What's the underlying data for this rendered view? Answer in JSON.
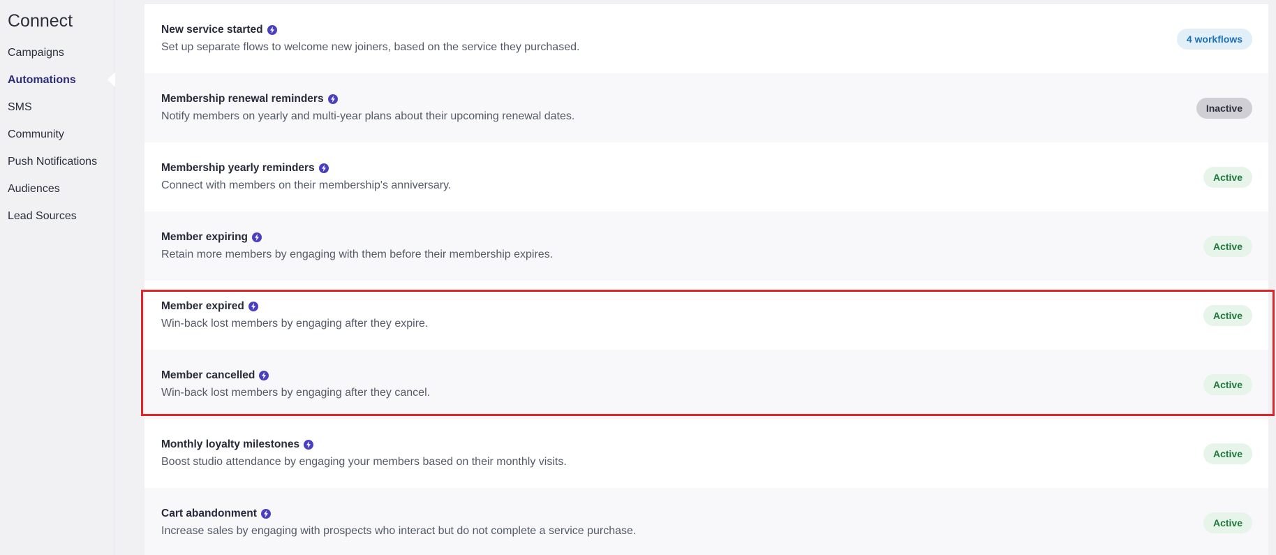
{
  "sidebar": {
    "title": "Connect",
    "items": [
      {
        "label": "Campaigns",
        "active": false
      },
      {
        "label": "Automations",
        "active": true
      },
      {
        "label": "SMS",
        "active": false
      },
      {
        "label": "Community",
        "active": false
      },
      {
        "label": "Push Notifications",
        "active": false
      },
      {
        "label": "Audiences",
        "active": false
      },
      {
        "label": "Lead Sources",
        "active": false
      }
    ]
  },
  "automations": [
    {
      "title": "New service started",
      "description": "Set up separate flows to welcome new joiners, based on the service they purchased.",
      "status": "4 workflows",
      "status_type": "workflows"
    },
    {
      "title": "Membership renewal reminders",
      "description": "Notify members on yearly and multi-year plans about their upcoming renewal dates.",
      "status": "Inactive",
      "status_type": "inactive"
    },
    {
      "title": "Membership yearly reminders",
      "description": "Connect with members on their membership's anniversary.",
      "status": "Active",
      "status_type": "active"
    },
    {
      "title": "Member expiring",
      "description": "Retain more members by engaging with them before their membership expires.",
      "status": "Active",
      "status_type": "active"
    },
    {
      "title": "Member expired",
      "description": "Win-back lost members by engaging after they expire.",
      "status": "Active",
      "status_type": "active"
    },
    {
      "title": "Member cancelled",
      "description": "Win-back lost members by engaging after they cancel.",
      "status": "Active",
      "status_type": "active"
    },
    {
      "title": "Monthly loyalty milestones",
      "description": "Boost studio attendance by engaging your members based on their monthly visits.",
      "status": "Active",
      "status_type": "active"
    },
    {
      "title": "Cart abandonment",
      "description": "Increase sales by engaging with prospects who interact but do not complete a service purchase.",
      "status": "Active",
      "status_type": "active"
    }
  ],
  "icons": {
    "row_icon": "lightning-bolt-icon"
  },
  "colors": {
    "accent": "#2d2c7a",
    "bolt": "#4a3fc1",
    "active_bg": "#e6f4ea",
    "active_text": "#1e7a3c",
    "highlight": "#e0262b"
  }
}
